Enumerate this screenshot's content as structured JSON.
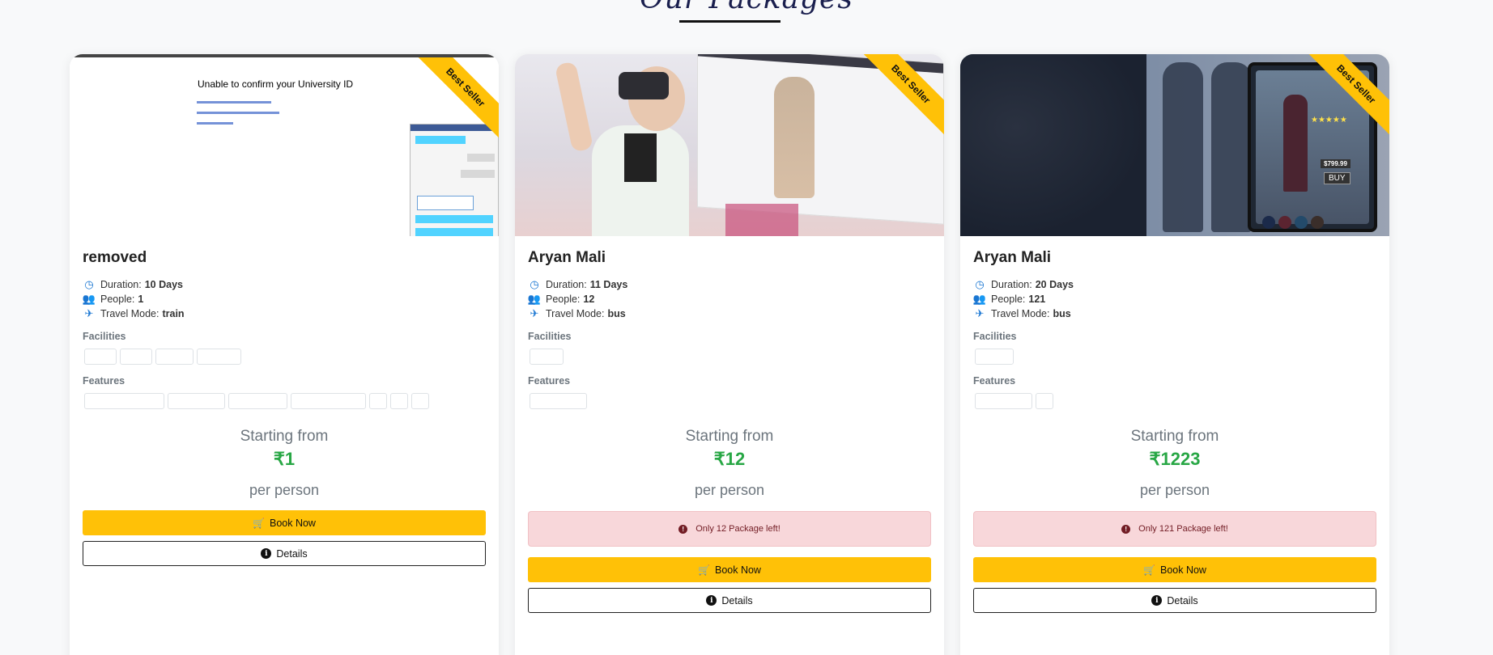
{
  "section": {
    "title": "Our Packages"
  },
  "labels": {
    "duration": "Duration:",
    "people": "People:",
    "travel_mode": "Travel Mode:",
    "facilities": "Facilities",
    "features": "Features",
    "starting_from": "Starting from",
    "per_person": "per person",
    "book_now": "Book Now",
    "details": "Details",
    "ribbon": "Best Seller"
  },
  "cards": [
    {
      "title": "removed",
      "duration": "10 Days",
      "people": "1",
      "travel_mode": "train",
      "price": "₹1",
      "alert": "",
      "thumb_text": "Unable to confirm your University ID"
    },
    {
      "title": "Aryan Mali",
      "duration": "11 Days",
      "people": "12",
      "travel_mode": "bus",
      "price": "₹12",
      "alert": "Only 12 Package left!"
    },
    {
      "title": "Aryan Mali",
      "duration": "20 Days",
      "people": "121",
      "travel_mode": "bus",
      "price": "₹1223",
      "alert": "Only 121 Package left!",
      "thumb_price": "$799.99",
      "thumb_buy": "BUY"
    }
  ],
  "colors": {
    "accent": "#ffc107",
    "price": "#28a745",
    "alert_bg": "#f8d7da",
    "icon": "#1976d2"
  },
  "icons": [
    "clock-icon",
    "users-icon",
    "plane-icon",
    "cart-icon",
    "info-icon",
    "exclamation-icon"
  ]
}
